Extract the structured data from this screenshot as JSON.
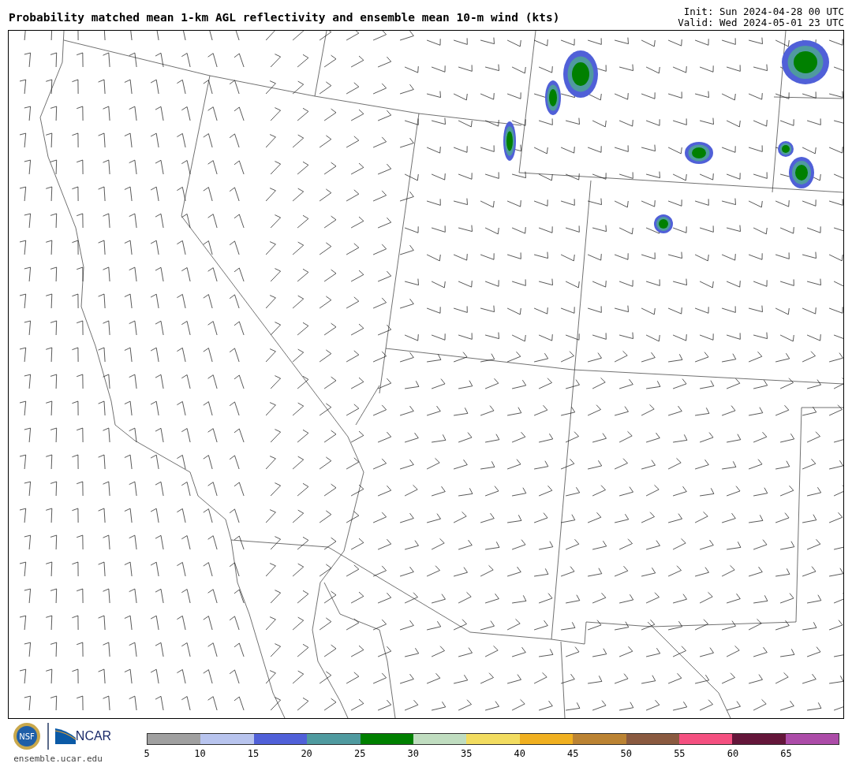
{
  "header": {
    "title": "Probability matched mean 1-km AGL reflectivity and ensemble mean 10-m wind (kts)",
    "init": "Init: Sun 2024-04-28 00 UTC",
    "valid": "Valid: Wed 2024-05-01 23 UTC"
  },
  "footer": {
    "nsf_logo": "NSF",
    "ncar_logo": "NCAR",
    "site": "ensemble.ucar.edu"
  },
  "colorbar": {
    "segments": [
      {
        "color": "#a0a0a0"
      },
      {
        "color": "#b8c4ee"
      },
      {
        "color": "#5060d8"
      },
      {
        "color": "#4f9a9f"
      },
      {
        "color": "#008000"
      },
      {
        "color": "#c0ddc0"
      },
      {
        "color": "#f2dc60"
      },
      {
        "color": "#f0b020"
      },
      {
        "color": "#bb8333"
      },
      {
        "color": "#8a5a40"
      },
      {
        "color": "#f45080"
      },
      {
        "color": "#64163a"
      },
      {
        "color": "#ac4ca8"
      }
    ],
    "ticks": [
      "5",
      "10",
      "15",
      "20",
      "25",
      "30",
      "35",
      "40",
      "45",
      "50",
      "55",
      "60",
      "65"
    ]
  }
}
